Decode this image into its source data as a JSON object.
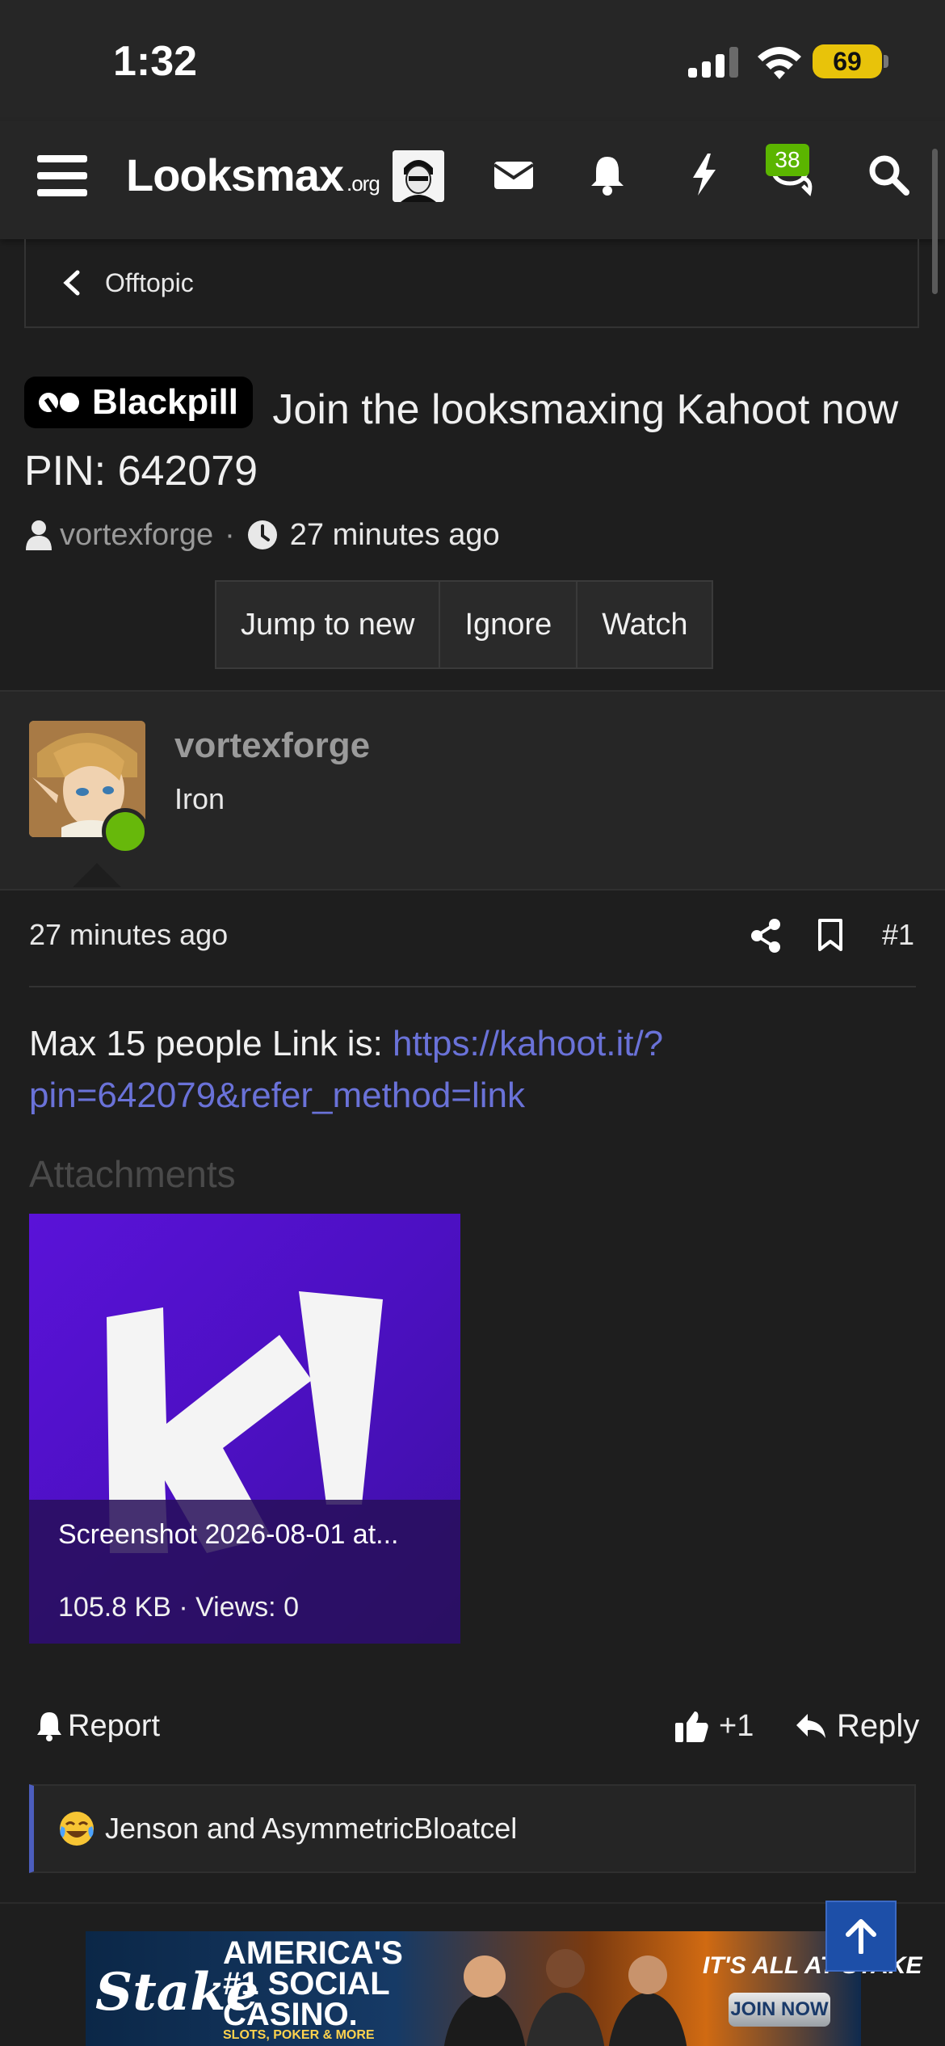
{
  "status_bar": {
    "time": "1:32",
    "battery": "69"
  },
  "nav": {
    "logo_main": "Looksmax",
    "logo_suffix": ".org",
    "conversations_badge": "38"
  },
  "breadcrumb": {
    "label": "Offtopic"
  },
  "thread": {
    "prefix": "Blackpill",
    "title": "Join the looksmaxing Kahoot now PIN: 642079",
    "author": "vortexforge",
    "separator": "·",
    "time": "27 minutes ago",
    "buttons": {
      "jump": "Jump to new",
      "ignore": "Ignore",
      "watch": "Watch"
    }
  },
  "post": {
    "username": "vortexforge",
    "rank": "Iron",
    "time": "27 minutes ago",
    "number": "#1",
    "text_before": "Max 15 people Link is: ",
    "link": "https://kahoot.it/?pin=642079&refer_method=link",
    "attachments_title": "Attachments",
    "attachment": {
      "logo_text": "K!",
      "name": "Screenshot 2026-08-01 at...",
      "info": "105.8 KB · Views: 0"
    },
    "report_label": "Report",
    "like_count": "+1",
    "reply_label": "Reply",
    "reactions": "Jenson and AsymmetricBloatcel"
  },
  "ad": {
    "brand": "Stake",
    "headline": "AMERICA'S\n#1 SOCIAL\nCASINO.",
    "sub": "SLOTS, POKER & MORE",
    "tagline": "IT'S ALL AT STAKE",
    "cta": "JOIN NOW"
  },
  "colors": {
    "background": "#1e1e1e",
    "header": "#262626",
    "link": "#6a72d8",
    "online": "#67b80b",
    "badge": "#5bb500",
    "battery": "#e8c30a",
    "attachment": "#5a12d8",
    "to_top": "#1d4fa8"
  },
  "icons": [
    "signal-icon",
    "wifi-icon",
    "menu-icon",
    "envelope-icon",
    "bell-icon",
    "bolt-icon",
    "chat-icon",
    "search-icon",
    "chevron-left-icon",
    "user-icon",
    "clock-icon",
    "share-icon",
    "bookmark-icon",
    "report-bell-icon",
    "thumbs-up-icon",
    "reply-icon",
    "crying-laughing-emoji",
    "arrow-up-icon"
  ]
}
